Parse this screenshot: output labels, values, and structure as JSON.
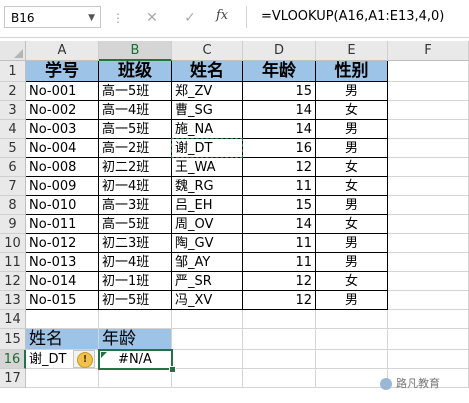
{
  "name_box": "B16",
  "formula": "=VLOOKUP(A16,A1:E13,4,0)",
  "icons": {
    "cancel": "close-icon",
    "confirm": "check-icon",
    "function": "fx-icon"
  },
  "fx_label": "fx",
  "columns": [
    "A",
    "B",
    "C",
    "D",
    "E",
    "F"
  ],
  "rows": [
    "1",
    "2",
    "3",
    "4",
    "5",
    "6",
    "7",
    "8",
    "9",
    "10",
    "11",
    "12",
    "13",
    "14",
    "15",
    "16",
    "17"
  ],
  "header": [
    "学号",
    "班级",
    "姓名",
    "年龄",
    "性别"
  ],
  "data": [
    [
      "No-001",
      "高一5班",
      "郑_ZV",
      "15",
      "男"
    ],
    [
      "No-002",
      "高一4班",
      "曹_SG",
      "14",
      "女"
    ],
    [
      "No-003",
      "高一5班",
      "施_NA",
      "14",
      "男"
    ],
    [
      "No-004",
      "高一2班",
      "谢_DT",
      "16",
      "男"
    ],
    [
      "No-008",
      "初二2班",
      "王_WA",
      "12",
      "女"
    ],
    [
      "No-009",
      "初一4班",
      "魏_RG",
      "11",
      "女"
    ],
    [
      "No-010",
      "高一3班",
      "吕_EH",
      "15",
      "男"
    ],
    [
      "No-011",
      "高一5班",
      "周_OV",
      "14",
      "女"
    ],
    [
      "No-012",
      "初二3班",
      "陶_GV",
      "11",
      "男"
    ],
    [
      "No-013",
      "初一4班",
      "邹_AY",
      "11",
      "男"
    ],
    [
      "No-014",
      "初一1班",
      "严_SR",
      "12",
      "女"
    ],
    [
      "No-015",
      "初一5班",
      "冯_XV",
      "12",
      "男"
    ]
  ],
  "lookup": {
    "label_name": "姓名",
    "label_age": "年龄",
    "name_value": "谢_DT",
    "result": "#N/A"
  },
  "error_indicator": "!",
  "watermark": "路凡教育",
  "colors": {
    "header_fill": "#9dc3e6",
    "selection": "#217346"
  }
}
